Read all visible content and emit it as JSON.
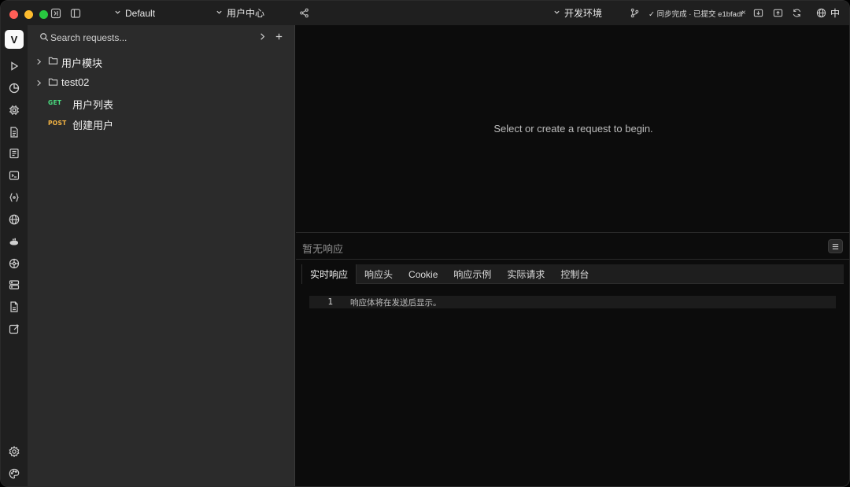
{
  "titlebar": {
    "workspace": "Default",
    "project": "用户中心",
    "environment": "开发环境",
    "sync_status": "✓ 同步完成 · 已提交 e1bfadf",
    "dismiss": "×",
    "language": "中"
  },
  "rail": {
    "logo": "V"
  },
  "sidebar": {
    "search_placeholder": "Search requests...",
    "folders": [
      {
        "label": "用户模块"
      },
      {
        "label": "test02"
      }
    ],
    "requests": [
      {
        "method": "GET",
        "label": "用户列表"
      },
      {
        "method": "POST",
        "label": "创建用户"
      }
    ]
  },
  "main": {
    "empty_message": "Select or create a request to begin."
  },
  "response": {
    "title": "暂无响应",
    "tabs": [
      {
        "label": "实时响应"
      },
      {
        "label": "响应头"
      },
      {
        "label": "Cookie"
      },
      {
        "label": "响应示例"
      },
      {
        "label": "实际请求"
      },
      {
        "label": "控制台"
      }
    ],
    "body": {
      "line_number": "1",
      "text": "响应体将在发送后显示。"
    }
  },
  "colors": {
    "get": "#4ade80",
    "post": "#f5b544",
    "background": "#0c0c0c",
    "sidebar": "#2b2b2b"
  }
}
